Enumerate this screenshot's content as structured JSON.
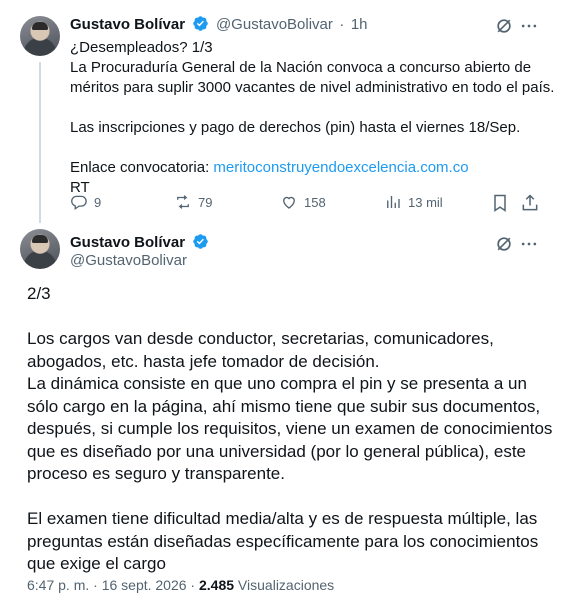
{
  "colors": {
    "text": "#0f1419",
    "muted": "#536471",
    "link": "#1d9bf0",
    "verified": "#1d9bf0",
    "line": "#cfd9de"
  },
  "tweet1": {
    "author_name": "Gustavo Bolívar",
    "handle": "@GustavoBolivar",
    "separator": "·",
    "time": "1h",
    "lines": [
      "¿Desempleados? 1/3",
      "La Procuraduría General de la Nación convoca a concurso abierto de",
      "méritos para suplir 3000 vacantes de nivel administrativo en todo el país."
    ],
    "line2": "Las inscripciones y pago de derechos (pin) hasta el viernes 18/Sep.",
    "link_prefix": "Enlace convocatoria: ",
    "link_text": "meritoconstruyendoexcelencia.com.co",
    "tail": "RT",
    "actions": {
      "replies": "9",
      "reposts": "79",
      "likes": "158",
      "views": "13 mil"
    },
    "icons": [
      "grok-icon",
      "more-icon",
      "reply-icon",
      "repost-icon",
      "like-icon",
      "views-icon",
      "bookmark-icon",
      "share-icon"
    ]
  },
  "tweet2": {
    "author_name": "Gustavo Bolívar",
    "handle": "@GustavoBolivar",
    "paragraphs": [
      "2/3",
      "Los cargos van desde conductor, secretarias, comunicadores, abogados, etc. hasta jefe tomador de decisión.",
      "La dinámica consiste en que uno compra el pin y se presenta a un sólo cargo en la página, ahí mismo tiene que subir sus documentos, después, si cumple los requisitos, viene un examen de conocimientos que es diseñado por una universidad (por lo general pública), este proceso es seguro y transparente.",
      "El examen tiene dificultad media/alta y es de respuesta múltiple, las preguntas están diseñadas específicamente para los conocimientos que exige el cargo"
    ],
    "timestamp": "6:47 p. m. · 16 sept. 2026 · ",
    "views_count": "2.485",
    "views_label": " Visualizaciones"
  }
}
